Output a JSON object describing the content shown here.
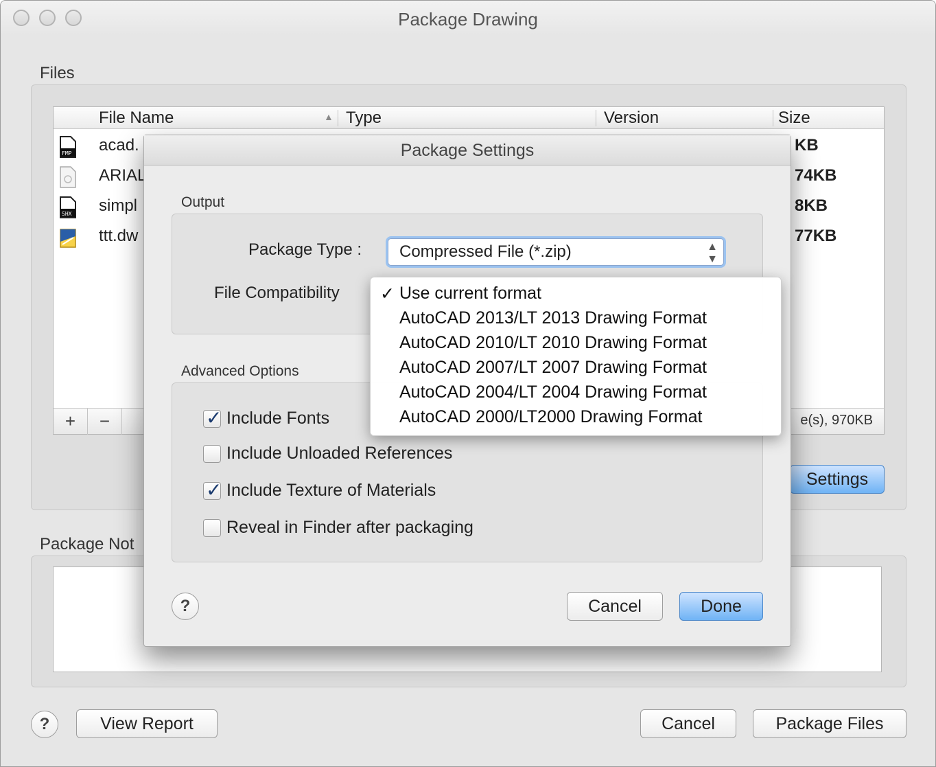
{
  "window": {
    "title": "Package Drawing"
  },
  "files": {
    "section_label": "Files",
    "columns": [
      "File Name",
      "Type",
      "Version",
      "Size"
    ],
    "rows": [
      {
        "icon": "fmp-file-icon",
        "name": "acad.",
        "size": "KB"
      },
      {
        "icon": "font-file-icon",
        "name": "ARIAL",
        "size": "74KB"
      },
      {
        "icon": "shx-file-icon",
        "name": "simpl",
        "size": "8KB"
      },
      {
        "icon": "dwg-file-icon",
        "name": "ttt.dw",
        "size": "77KB"
      }
    ],
    "add_label": "+",
    "remove_label": "−",
    "summary": "e(s), 970KB",
    "settings_button": "Settings"
  },
  "notes": {
    "section_label": "Package Not"
  },
  "footer": {
    "help_label": "?",
    "view_report": "View Report",
    "cancel": "Cancel",
    "package_files": "Package Files"
  },
  "settings": {
    "title": "Package Settings",
    "output_label": "Output",
    "package_type_label": "Package Type :",
    "package_type_value": "Compressed File (*.zip)",
    "compat_label": "File Compatibility",
    "advanced_label": "Advanced Options",
    "options": [
      {
        "label": "Include Fonts",
        "checked": true
      },
      {
        "label": "Include Unloaded References",
        "checked": false
      },
      {
        "label": "Include Texture of Materials",
        "checked": true
      },
      {
        "label": "Reveal in Finder after packaging",
        "checked": false
      }
    ],
    "help_label": "?",
    "cancel": "Cancel",
    "done": "Done"
  },
  "compat_menu": {
    "check_glyph": "✓",
    "items": [
      {
        "label": "Use current format",
        "selected": true
      },
      {
        "label": "AutoCAD 2013/LT 2013 Drawing Format",
        "selected": false
      },
      {
        "label": "AutoCAD 2010/LT 2010 Drawing Format",
        "selected": false
      },
      {
        "label": "AutoCAD 2007/LT 2007 Drawing Format",
        "selected": false
      },
      {
        "label": "AutoCAD 2004/LT 2004 Drawing Format",
        "selected": false
      },
      {
        "label": "AutoCAD 2000/LT2000 Drawing Format",
        "selected": false
      }
    ]
  },
  "colors": {
    "accent": "#6fb3f5",
    "check": "#1a3a6e"
  }
}
